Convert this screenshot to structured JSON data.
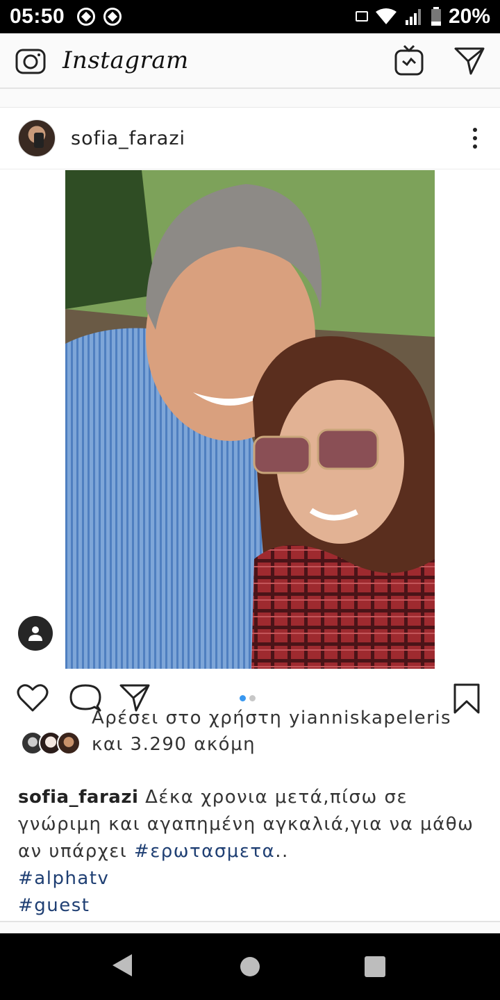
{
  "status_bar": {
    "time": "05:50",
    "battery": "20%"
  },
  "header": {
    "app_name": "Instagram"
  },
  "post": {
    "username": "sofia_farazi",
    "likes_text_line1": "Αρέσει στο χρήστη yianniskapeleris",
    "likes_text_line2": "και 3.290 ακόμη",
    "caption_user": "sofia_farazi",
    "caption_text": "Δέκα χρονια μετά,πίσω σε γνώριμη και αγαπημένη αγκαλιά,για να μάθω αν υπάρχει",
    "hashtag_1": "#ερωτασμετα",
    "hashtag_1_suffix": "..",
    "hashtag_2": "#alphatv",
    "hashtag_3": "#guest",
    "carousel_index": 1,
    "carousel_count": 2
  },
  "icons": {
    "camera": "camera-icon",
    "igtv": "igtv-icon",
    "direct": "direct-message-icon",
    "more": "more-options-icon",
    "tags": "user-tags-icon",
    "like": "heart-icon",
    "comment": "comment-icon",
    "share": "share-icon",
    "save": "bookmark-icon"
  },
  "colors": {
    "accent_blue": "#3897f0",
    "hashtag": "#1f3f73"
  }
}
